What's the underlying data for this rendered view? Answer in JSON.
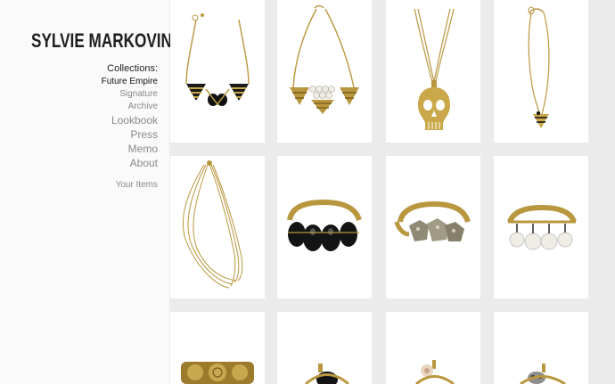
{
  "brand": {
    "name": "SYLVIE MARKOVINA"
  },
  "nav": {
    "collections_label": "Collections:",
    "collections": [
      {
        "label": "Future Empire",
        "active": true
      },
      {
        "label": "Signature",
        "active": false
      },
      {
        "label": "Archive",
        "active": false
      }
    ],
    "main": [
      {
        "label": "Lookbook"
      },
      {
        "label": "Press"
      },
      {
        "label": "Memo"
      },
      {
        "label": "About"
      }
    ],
    "your_items": "Your Items"
  },
  "products": [
    {
      "icon": "triangle-bib-necklace-black-icon"
    },
    {
      "icon": "triangle-bib-necklace-pearl-icon"
    },
    {
      "icon": "skull-pendant-necklace-icon"
    },
    {
      "icon": "bee-pendant-necklace-icon"
    },
    {
      "icon": "multi-strand-chain-necklace-icon"
    },
    {
      "icon": "black-stone-cuff-icon"
    },
    {
      "icon": "pyrite-cuff-icon"
    },
    {
      "icon": "pearl-cuff-icon"
    },
    {
      "icon": "engraved-wide-cuff-icon"
    },
    {
      "icon": "black-stone-ring-icon"
    },
    {
      "icon": "rose-ring-icon"
    },
    {
      "icon": "skull-ring-icon"
    }
  ],
  "colors": {
    "gold": "#b9973f",
    "dark_gold": "#8a6a22",
    "black_stone": "#141414",
    "pearl": "#f0ede6",
    "pyrite": "#8f8a76"
  }
}
